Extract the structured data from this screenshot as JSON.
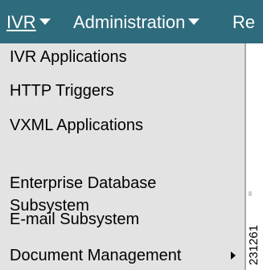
{
  "menubar": {
    "items": [
      {
        "label": "IVR",
        "active": true
      },
      {
        "label": "Administration",
        "active": false
      },
      {
        "label": "Re",
        "active": false
      }
    ]
  },
  "dropdown": {
    "items": [
      {
        "label": "IVR Applications"
      },
      {
        "label": "HTTP Triggers"
      },
      {
        "label": "VXML Applications"
      },
      {
        "label": "Enterprise Database\nSubsystem"
      },
      {
        "label": "E-mail Subsystem"
      },
      {
        "label": "Document Management",
        "has_submenu": true
      }
    ]
  },
  "figure_id": "231261",
  "colors": {
    "menubar_bg": "#2e6b7c",
    "dropdown_bg": "#e3e3e3",
    "text": "#000000",
    "menubar_text": "#ffffff"
  }
}
